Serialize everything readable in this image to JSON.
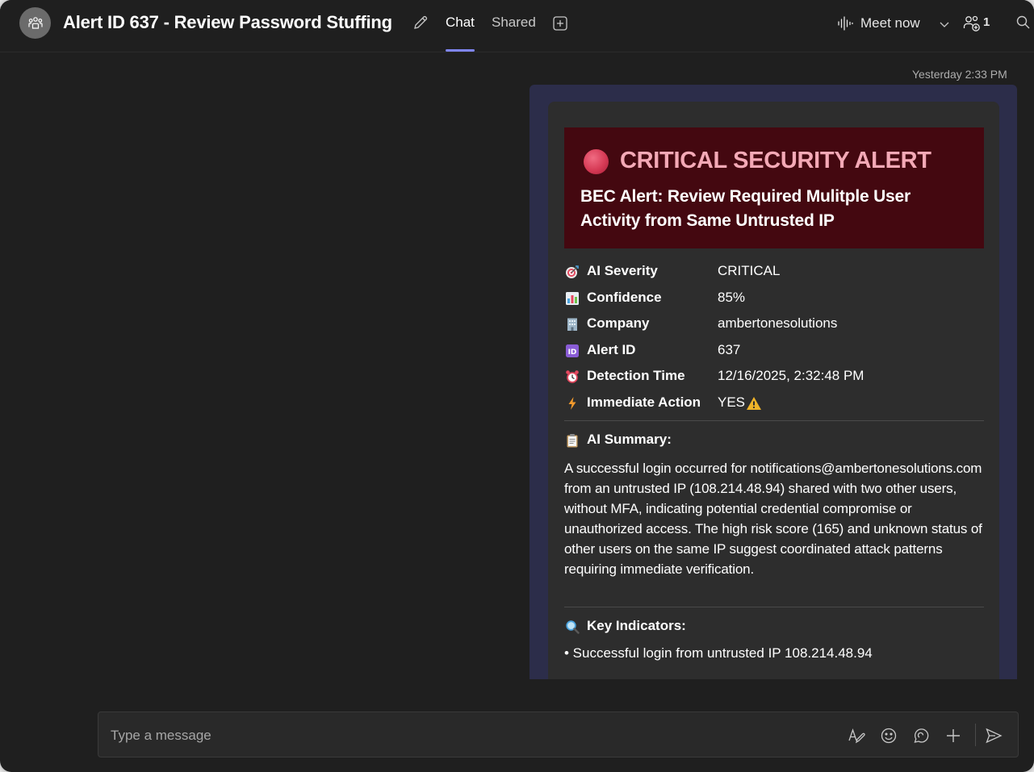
{
  "header": {
    "title": "Alert ID 637 - Review Password Stuffing",
    "tabs": [
      {
        "label": "Chat",
        "active": true
      },
      {
        "label": "Shared",
        "active": false
      }
    ],
    "meet_label": "Meet now",
    "participant_count": "1",
    "icons": [
      "group-avatar-icon",
      "edit-pencil-icon",
      "add-tab-icon",
      "meet-waveform-icon",
      "chevron-down-icon",
      "people-add-icon",
      "search-icon"
    ]
  },
  "message": {
    "timestamp": "Yesterday 2:33 PM",
    "card": {
      "alert_heading": "CRITICAL SECURITY ALERT",
      "alert_subtitle": "BEC Alert: Review Required Mulitple User Activity from Same Untrusted IP",
      "fields": [
        {
          "icon": "target-icon",
          "label": "AI Severity",
          "value": "CRITICAL"
        },
        {
          "icon": "bar-chart-icon",
          "label": "Confidence",
          "value": "85%"
        },
        {
          "icon": "office-building-icon",
          "label": "Company",
          "value": "ambertonesolutions"
        },
        {
          "icon": "id-badge-icon",
          "label": "Alert ID",
          "value": "637"
        },
        {
          "icon": "alarm-clock-icon",
          "label": "Detection Time",
          "value": "12/16/2025, 2:32:48 PM"
        },
        {
          "icon": "lightning-icon",
          "label": "Immediate Action",
          "value": "YES"
        }
      ],
      "summary_heading": "AI Summary:",
      "summary_text": "A successful login occurred for notifications@ambertonesolutions.com from an untrusted IP (108.214.48.94) shared with two other users, without MFA, indicating potential credential compromise or unauthorized access. The high risk score (165) and unknown status of other users on the same IP suggest coordinated attack patterns requiring immediate verification.",
      "indicators_heading": "Key Indicators:",
      "indicators": [
        "• Successful login from untrusted IP 108.214.48.94"
      ]
    }
  },
  "compose": {
    "placeholder": "Type a message",
    "icons": [
      "format-icon",
      "emoji-icon",
      "loop-icon",
      "plus-icon",
      "send-icon"
    ]
  },
  "colors": {
    "window_bg": "#1f1f1f",
    "bubble_bg": "#2c2d4a",
    "card_bg": "#2d2d2d",
    "alert_banner_bg": "#440810",
    "alert_heading": "#f4a9b6",
    "accent": "#7f85f5"
  }
}
